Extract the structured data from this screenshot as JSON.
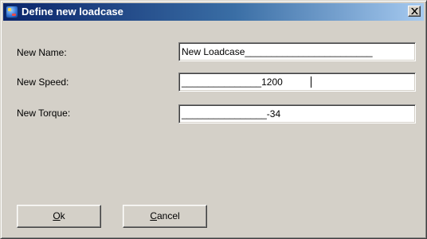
{
  "window": {
    "title": "Define new loadcase",
    "icon": "app-icon",
    "close_glyph": "×"
  },
  "form": {
    "name": {
      "label": "New Name:",
      "value": "New Loadcase________________________"
    },
    "speed": {
      "label": "New Speed:",
      "value": "_______________1200"
    },
    "torque": {
      "label": "New Torque:",
      "value": "________________-34"
    }
  },
  "buttons": {
    "ok": {
      "mnemonic": "O",
      "rest": "k"
    },
    "cancel": {
      "mnemonic": "C",
      "rest": "ancel"
    }
  },
  "colors": {
    "face": "#d4d0c8",
    "title_start": "#0a246a",
    "title_end": "#a6caf0",
    "field_bg": "#ffffff"
  }
}
